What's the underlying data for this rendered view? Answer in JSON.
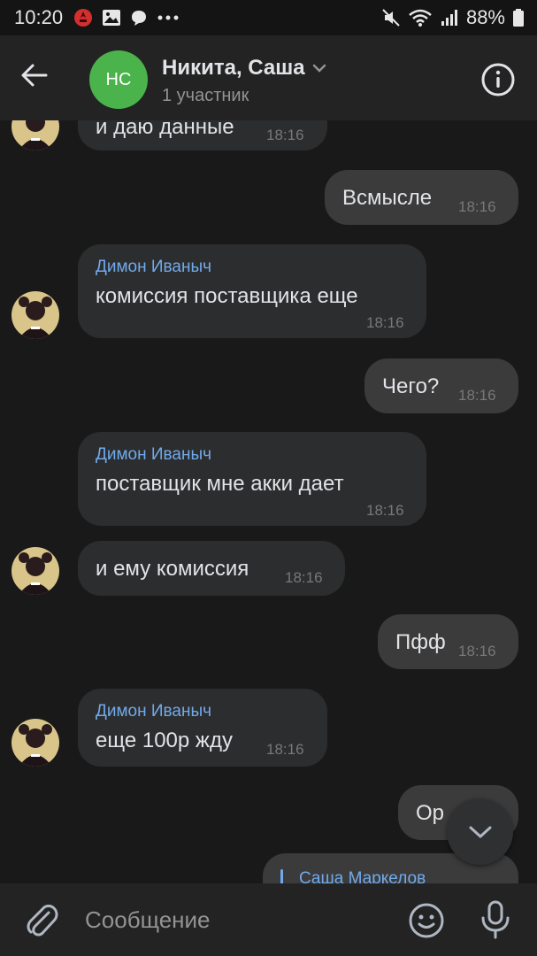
{
  "status_bar": {
    "time": "10:20",
    "battery": "88%",
    "icons": [
      "notification-icon",
      "gallery-icon",
      "chat-icon",
      "more-dots-icon",
      "mute-icon",
      "wifi-icon",
      "signal-icon",
      "battery-icon"
    ]
  },
  "header": {
    "avatar_initials": "НС",
    "title": "Никита, Саша",
    "subtitle": "1 участник",
    "avatar_color": "#4bb34b"
  },
  "messages": [
    {
      "direction": "in",
      "text": "и даю данные",
      "time": "18:16"
    },
    {
      "direction": "out",
      "text": "Всмысле",
      "time": "18:16"
    },
    {
      "direction": "in",
      "author": "Димон Иваныч",
      "text": "комиссия поставщика еще",
      "time": "18:16"
    },
    {
      "direction": "out",
      "text": "Чего?",
      "time": "18:16"
    },
    {
      "direction": "in",
      "author": "Димон Иваныч",
      "text": "поставщик мне акки дает",
      "time": "18:16"
    },
    {
      "direction": "in",
      "text": "и ему комиссия",
      "time": "18:16"
    },
    {
      "direction": "out",
      "text": "Пфф",
      "time": "18:16"
    },
    {
      "direction": "in",
      "author": "Димон Иваныч",
      "text": "еще 100р жду",
      "time": "18:16"
    },
    {
      "direction": "out",
      "text": "Ор"
    },
    {
      "direction": "out",
      "reply_author": "Саша Маркелов"
    }
  ],
  "composer": {
    "placeholder": "Сообщение"
  },
  "colors": {
    "background": "#191919",
    "bubble_in": "#2c2d2e",
    "bubble_out": "#3b3b3c",
    "author_name": "#71aaeb",
    "header": "#232323"
  }
}
